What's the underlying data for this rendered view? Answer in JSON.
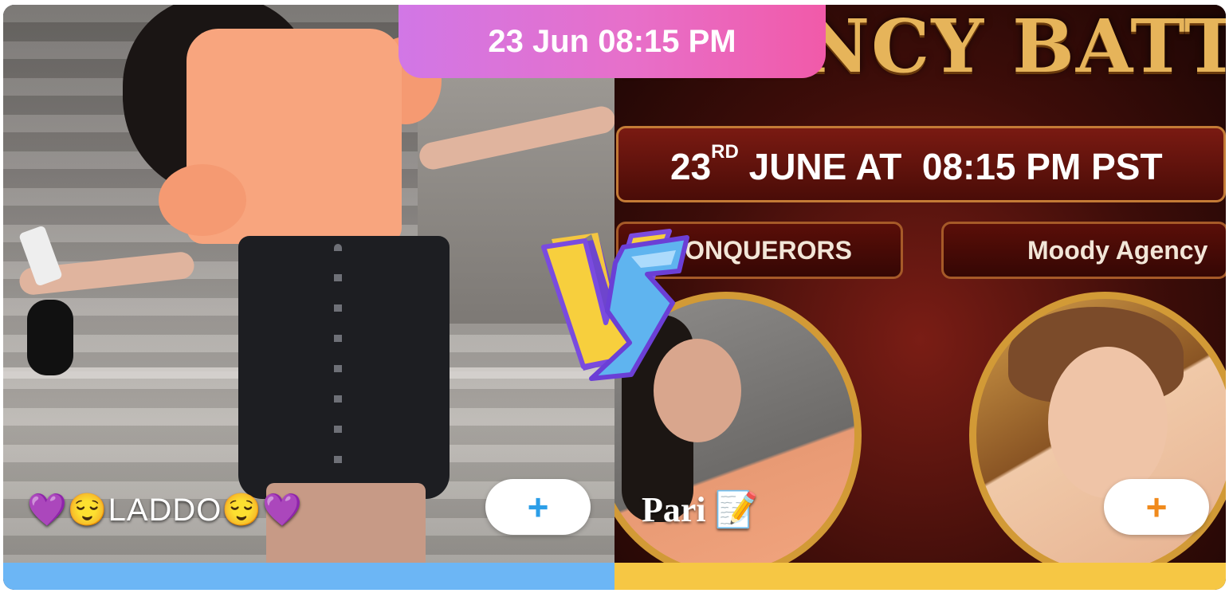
{
  "header": {
    "date_time": "23 Jun 08:15 PM"
  },
  "left_host": {
    "name": "💜😌LADDO😌💜",
    "follow_label": "+",
    "bar_color": "#6cb6f5"
  },
  "banner": {
    "title": "AGENCY BATTLE",
    "date_line": {
      "day": "23",
      "suffix": "RD",
      "rest": " JUNE AT  08:15 PM PST"
    },
    "agency_left": "CONQUERORS",
    "agency_right": "Moody Agency"
  },
  "right_host": {
    "name": "Pari 📝",
    "follow_label": "+",
    "bar_color": "#f6c744"
  },
  "vs_icon": "versus-badge",
  "colors": {
    "pill_start": "#d177e6",
    "pill_end": "#f15aa9",
    "left_accent": "#2b9ee8",
    "right_accent": "#f08a1c"
  }
}
